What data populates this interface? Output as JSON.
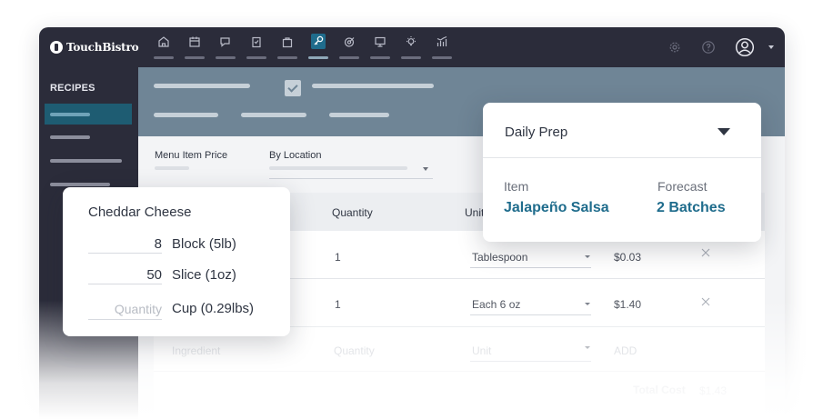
{
  "app": {
    "brand": "TouchBistro",
    "colors": {
      "nav_bg": "#2b2c3a",
      "accent": "#1f6c8c",
      "header_band": "#6f8596"
    }
  },
  "topbar": {
    "icons": [
      "home-icon",
      "calendar-icon",
      "chat-icon",
      "clipboard-icon",
      "shopping-bag-icon",
      "key-icon",
      "target-icon",
      "monitor-icon",
      "lightbulb-icon",
      "chart-icon"
    ],
    "active_icon": "key-icon",
    "right_icons": [
      "gear-icon",
      "help-icon",
      "user-icon",
      "chevron-down-icon"
    ]
  },
  "sidebar": {
    "title": "RECIPES"
  },
  "filters": {
    "menu_item_price": {
      "label": "Menu Item Price"
    },
    "by_location": {
      "label": "By Location"
    }
  },
  "table": {
    "headers": {
      "quantity": "Quantity",
      "unit": "Unit"
    },
    "rows": [
      {
        "quantity": "1",
        "unit": "Tablespoon",
        "cost": "$0.03"
      },
      {
        "quantity": "1",
        "unit": "Each 6 oz",
        "cost": "$1.40"
      }
    ],
    "new_row": {
      "ingredient_placeholder": "Ingredient",
      "quantity_placeholder": "Quantity",
      "unit_placeholder": "Unit",
      "add_label": "ADD"
    },
    "total": {
      "label": "Total Cost",
      "value": "$1.43"
    }
  },
  "ingredient_card": {
    "title": "Cheddar Cheese",
    "rows": [
      {
        "quantity": "8",
        "unit": "Block (5lb)"
      },
      {
        "quantity": "50",
        "unit": "Slice (1oz)"
      }
    ],
    "empty_row": {
      "quantity_placeholder": "Quantity",
      "unit": "Cup (0.29lbs)"
    }
  },
  "prep_card": {
    "title": "Daily Prep",
    "item_label": "Item",
    "item_value": "Jalapeño Salsa",
    "forecast_label": "Forecast",
    "forecast_value": "2 Batches"
  }
}
